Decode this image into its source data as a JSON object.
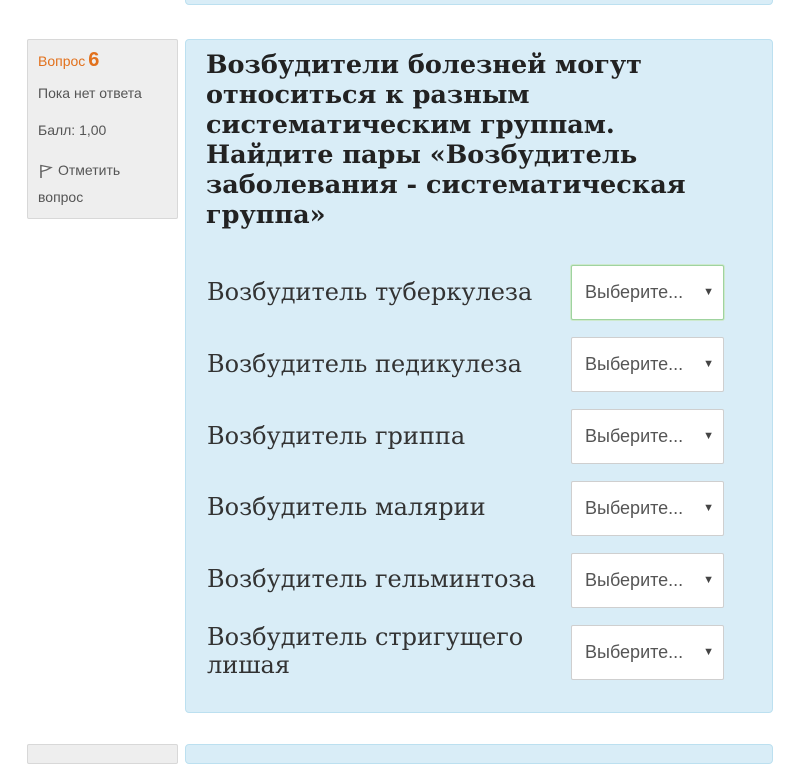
{
  "question": {
    "number_label": "Вопрос",
    "number": "6",
    "state": "Пока нет ответа",
    "grade": "Балл: 1,00",
    "flag_label": "Отметить вопрос",
    "text": "Возбудители болезней могут относиться к разным систематическим группам. Найдите пары «Возбудитель заболевания - систематическая группа»",
    "rows": [
      {
        "label": "Возбудитель туберкулеза",
        "select": "Выберите..."
      },
      {
        "label": "Возбудитель педикулеза",
        "select": "Выберите..."
      },
      {
        "label": "Возбудитель гриппа",
        "select": "Выберите..."
      },
      {
        "label": "Возбудитель малярии",
        "select": "Выберите..."
      },
      {
        "label": "Возбудитель гельминтоза",
        "select": "Выберите..."
      },
      {
        "label": "Возбудитель стригущего лишая",
        "select": "Выберите..."
      }
    ]
  },
  "icons": {
    "flag": "flag-icon",
    "dropdown": "dropdown-arrow-icon"
  }
}
